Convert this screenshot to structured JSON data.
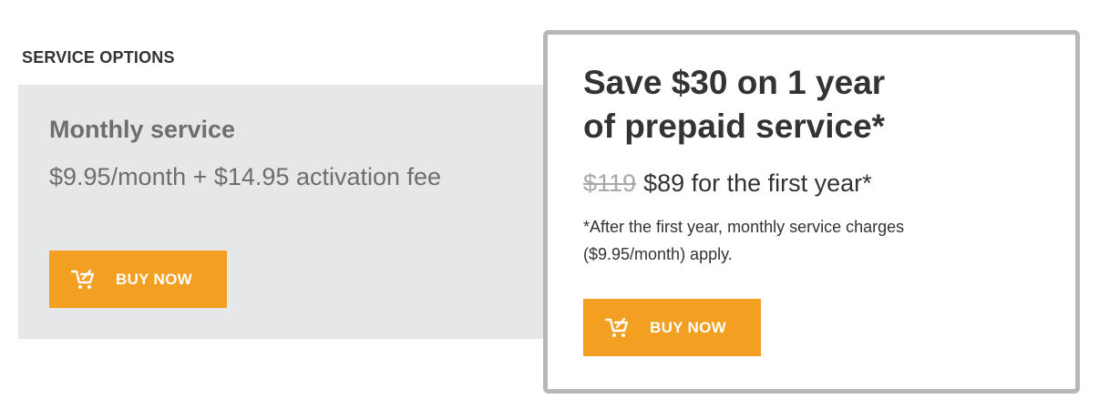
{
  "section": {
    "title": "SERVICE OPTIONS"
  },
  "monthly": {
    "title": "Monthly service",
    "price": "$9.95/month + $14.95 activation fee",
    "button_label": "BUY NOW",
    "button_icon": "cart-icon"
  },
  "prepaid": {
    "title_line1": "Save $30 on 1 year",
    "title_line2": "of prepaid service*",
    "old_price": "$119",
    "new_price": "$89 for the first year*",
    "note_line1": "*After the first year, monthly service charges",
    "note_line2": "($9.95/month) apply.",
    "button_label": "BUY NOW",
    "button_icon": "cart-icon"
  },
  "colors": {
    "accent": "#f29f22",
    "panel_bg": "#e6e7e8",
    "border": "#b6b7b9",
    "muted_text": "#6d6e70",
    "strikethrough_text": "#a7a9ac",
    "body_text": "#333333"
  }
}
